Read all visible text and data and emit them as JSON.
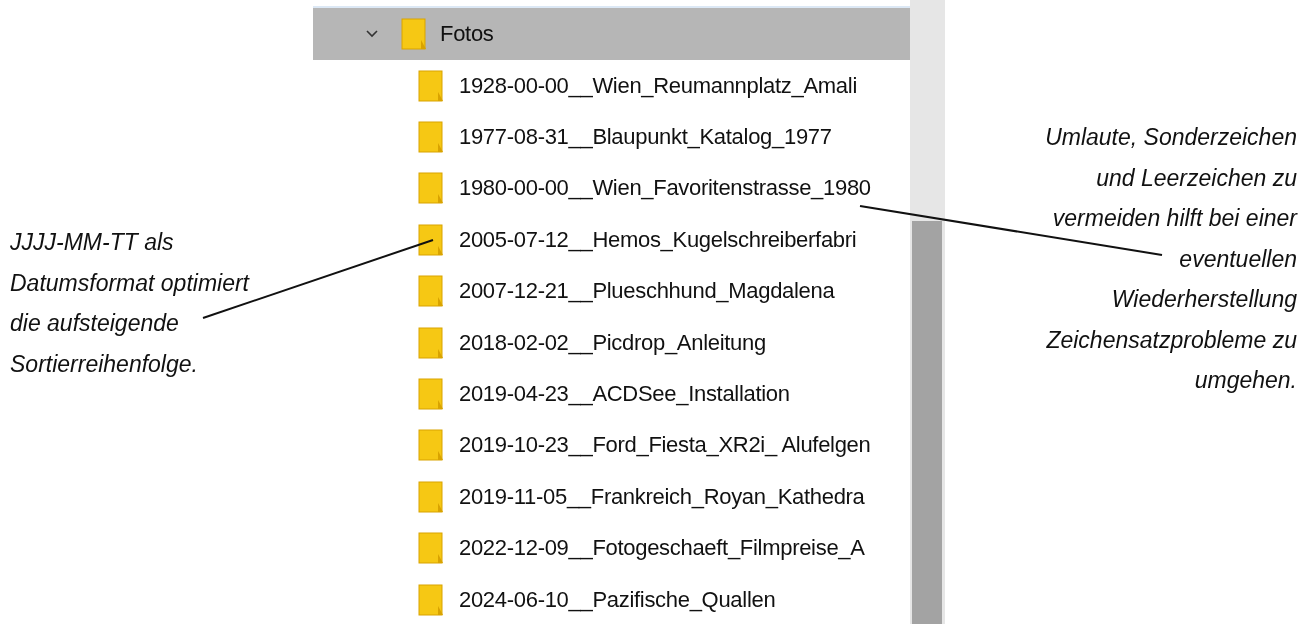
{
  "tree": {
    "folder": {
      "label": "Fotos",
      "expanded": true,
      "selected": true,
      "children": [
        {
          "label": "1928-00-00__Wien_Reumannplatz_Amali",
          "selected": false
        },
        {
          "label": "1977-08-31__Blaupunkt_Katalog_1977",
          "selected": false
        },
        {
          "label": "1980-00-00__Wien_Favoritenstrasse_1980",
          "selected": false
        },
        {
          "label": "2005-07-12__Hemos_Kugelschreiberfabri",
          "selected": false
        },
        {
          "label": "2007-12-21__Plueschhund_Magdalena",
          "selected": false
        },
        {
          "label": "2018-02-02__Picdrop_Anleitung",
          "selected": false
        },
        {
          "label": "2019-04-23__ACDSee_Installation",
          "selected": false
        },
        {
          "label": "2019-10-23__Ford_Fiesta_XR2i_ Alufelgen",
          "selected": false
        },
        {
          "label": "2019-11-05__Frankreich_Royan_Kathedra",
          "selected": false
        },
        {
          "label": "2022-12-09__Fotogeschaeft_Filmpreise_A",
          "selected": false
        },
        {
          "label": "2024-06-10__Pazifische_Quallen",
          "selected": false
        }
      ]
    }
  },
  "annotations": [
    {
      "kind": "left",
      "lines": [
        "JJJJ-MM-TT als",
        "Datumsformat optimiert",
        "die aufsteigende",
        "Sortierreihenfolge."
      ]
    },
    {
      "kind": "right",
      "lines": [
        "Umlaute, Sonderzeichen",
        "und Leerzeichen zu",
        "vermeiden hilft bei einer",
        "eventuellen",
        "Wiederherstellung",
        "Zeichensatzprobleme zu",
        "umgehen."
      ]
    }
  ]
}
